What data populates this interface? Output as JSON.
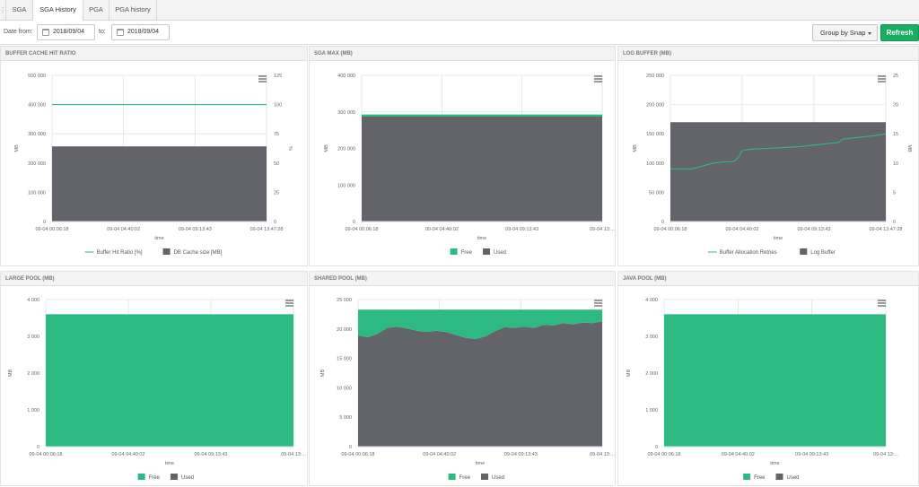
{
  "tabs": [
    {
      "label": "SGA",
      "active": false
    },
    {
      "label": "SGA History",
      "active": true
    },
    {
      "label": "PGA",
      "active": false
    },
    {
      "label": "PGA history",
      "active": false
    }
  ],
  "toolbar": {
    "date_from_label": "Date from:",
    "date_from_value": "2018/09/04",
    "to_label": "to:",
    "date_to_value": "2018/09/04",
    "group_by": "Group by Snap",
    "refresh_label": "Refresh"
  },
  "colors": {
    "used": "#62646a",
    "free": "#2dba82",
    "line": "#2dba82",
    "accent": "#1aae63"
  },
  "icons": [
    "calendar-icon",
    "chevron-down-icon",
    "menu-icon"
  ],
  "chart_data": [
    {
      "id": "buffer-cache",
      "title": "BUFFER CACHE HIT RATIO",
      "type": "area",
      "xlabel": "time",
      "ylabel": "MB",
      "y2label": "%",
      "yticks": [
        "500 000",
        "400 000",
        "300 000",
        "200 000",
        "100 000",
        "0"
      ],
      "y2ticks": [
        "125",
        "100",
        "75",
        "50",
        "25",
        "0"
      ],
      "ylim": [
        0,
        500000
      ],
      "y2lim": [
        0,
        125
      ],
      "xticks": [
        "09-04 00:06:18",
        "09-04 04:40:02",
        "09-04 09:13:43",
        "09-04 13:47:28"
      ],
      "x": [
        0,
        1
      ],
      "stack": [
        {
          "name": "DB Cache size [MB]",
          "values": [
            257000,
            257000
          ],
          "color": "#62646a"
        }
      ],
      "line": {
        "name": "Buffer Hit Ratio [%]",
        "values": [
          100,
          100
        ],
        "axis": "y2"
      },
      "legend": [
        {
          "name": "Buffer Hit Ratio [%]",
          "kind": "line"
        },
        {
          "name": "DB Cache size [MB]",
          "kind": "box",
          "color": "#62646a"
        }
      ]
    },
    {
      "id": "sga-max",
      "title": "SGA MAX (MB)",
      "type": "area",
      "xlabel": "time",
      "ylabel": "MB",
      "yticks": [
        "400 000",
        "300 000",
        "200 000",
        "100 000",
        "0"
      ],
      "ylim": [
        0,
        400000
      ],
      "xticks": [
        "09-04 00:06:18",
        "09-04 04:40:02",
        "09-04 09:13:43",
        "09-04 13:..."
      ],
      "x": [
        0,
        1
      ],
      "stack": [
        {
          "name": "Used",
          "values": [
            287000,
            287000
          ],
          "color": "#62646a"
        },
        {
          "name": "Free",
          "values": [
            6000,
            6000
          ],
          "color": "#2dba82"
        }
      ],
      "legend": [
        {
          "name": "Free",
          "kind": "box",
          "color": "#2dba82"
        },
        {
          "name": "Used",
          "kind": "box",
          "color": "#62646a"
        }
      ]
    },
    {
      "id": "log-buffer",
      "title": "LOG BUFFER (MB)",
      "type": "area",
      "xlabel": "time",
      "ylabel": "MB",
      "y2label": "MB",
      "yticks": [
        "250 000",
        "200 000",
        "150 000",
        "100 000",
        "50 000",
        "0"
      ],
      "y2ticks": [
        "25",
        "20",
        "15",
        "10",
        "5",
        "0"
      ],
      "ylim": [
        0,
        250000
      ],
      "y2lim": [
        0,
        25
      ],
      "xticks": [
        "09-04 00:06:18",
        "09-04 04:40:02",
        "09-04 09:13:43",
        "09-04 13:47:28"
      ],
      "x": [
        0,
        1
      ],
      "stack": [
        {
          "name": "Log Buffer",
          "values": [
            170000,
            170000
          ],
          "color": "#62646a"
        }
      ],
      "line": {
        "name": "Buffer Allocation Retries",
        "axis": "y2",
        "x": [
          0,
          0.1,
          0.2,
          0.25,
          0.28,
          0.3,
          0.32,
          0.33,
          0.34,
          0.36,
          0.38,
          0.4,
          0.45,
          0.5,
          0.55,
          0.6,
          0.65,
          0.7,
          0.75,
          0.78,
          0.8,
          0.85,
          0.9,
          0.95,
          1
        ],
        "values": [
          9,
          9,
          10,
          10.2,
          10.2,
          10.4,
          11.2,
          12,
          12.2,
          12.3,
          12.4,
          12.4,
          12.5,
          12.6,
          12.7,
          12.8,
          13,
          13.2,
          13.4,
          13.5,
          14.1,
          14.3,
          14.5,
          14.7,
          15
        ]
      },
      "legend": [
        {
          "name": "Buffer Allocation Retries",
          "kind": "line"
        },
        {
          "name": "Log Buffer",
          "kind": "box",
          "color": "#62646a"
        }
      ]
    },
    {
      "id": "large-pool",
      "title": "LARGE POOL (MB)",
      "type": "area",
      "xlabel": "time",
      "ylabel": "MB",
      "yticks": [
        "4 000",
        "3 000",
        "2 000",
        "1 000",
        "0"
      ],
      "ylim": [
        0,
        4000
      ],
      "xticks": [
        "09-04 00:06:18",
        "09-04 04:40:02",
        "09-04 09:13:43",
        "09-04 13:..."
      ],
      "x": [
        0,
        1
      ],
      "stack": [
        {
          "name": "Used",
          "values": [
            0,
            0
          ],
          "color": "#62646a"
        },
        {
          "name": "Free",
          "values": [
            3600,
            3600
          ],
          "color": "#2dba82"
        }
      ],
      "legend": [
        {
          "name": "Free",
          "kind": "box",
          "color": "#2dba82"
        },
        {
          "name": "Used",
          "kind": "box",
          "color": "#62646a"
        }
      ]
    },
    {
      "id": "shared-pool",
      "title": "SHARED POOL (MB)",
      "type": "area",
      "xlabel": "time",
      "ylabel": "MB",
      "yticks": [
        "25 000",
        "20 000",
        "15 000",
        "10 000",
        "5 000",
        "0"
      ],
      "ylim": [
        0,
        25000
      ],
      "xticks": [
        "09-04 00:06:18",
        "09-04 04:40:02",
        "09-04 09:13:43",
        "09-04 13:..."
      ],
      "x": [
        0,
        0.04,
        0.08,
        0.12,
        0.16,
        0.2,
        0.24,
        0.28,
        0.32,
        0.36,
        0.4,
        0.44,
        0.48,
        0.52,
        0.56,
        0.6,
        0.64,
        0.68,
        0.72,
        0.76,
        0.8,
        0.84,
        0.88,
        0.92,
        0.96,
        1
      ],
      "stack": [
        {
          "name": "Used",
          "values": [
            18900,
            18600,
            19200,
            20200,
            20400,
            20100,
            19700,
            19500,
            19700,
            19500,
            19000,
            18500,
            18300,
            18700,
            19600,
            20300,
            20200,
            20400,
            20200,
            20700,
            20600,
            21000,
            20800,
            21100,
            21000,
            21300
          ],
          "color": "#62646a"
        },
        {
          "name": "Free",
          "values": [
            4400,
            4700,
            4100,
            3100,
            2900,
            3200,
            3600,
            3800,
            3600,
            3800,
            4300,
            4800,
            5000,
            4600,
            3700,
            3000,
            3100,
            2900,
            3100,
            2600,
            2700,
            2300,
            2500,
            2200,
            2300,
            2000
          ],
          "color": "#2dba82"
        }
      ],
      "legend": [
        {
          "name": "Free",
          "kind": "box",
          "color": "#2dba82"
        },
        {
          "name": "Used",
          "kind": "box",
          "color": "#62646a"
        }
      ]
    },
    {
      "id": "java-pool",
      "title": "JAVA POOL (MB)",
      "type": "area",
      "xlabel": "time",
      "ylabel": "MB",
      "yticks": [
        "4 000",
        "3 000",
        "2 000",
        "1 000",
        "0"
      ],
      "ylim": [
        0,
        4000
      ],
      "xticks": [
        "09-04 00:06:18",
        "09-04 04:40:02",
        "09-04 09:13:43",
        "09-04 13:..."
      ],
      "x": [
        0,
        1
      ],
      "stack": [
        {
          "name": "Used",
          "values": [
            10,
            10
          ],
          "color": "#62646a"
        },
        {
          "name": "Free",
          "values": [
            3590,
            3590
          ],
          "color": "#2dba82"
        }
      ],
      "legend": [
        {
          "name": "Free",
          "kind": "box",
          "color": "#2dba82"
        },
        {
          "name": "Used",
          "kind": "box",
          "color": "#62646a"
        }
      ]
    }
  ]
}
